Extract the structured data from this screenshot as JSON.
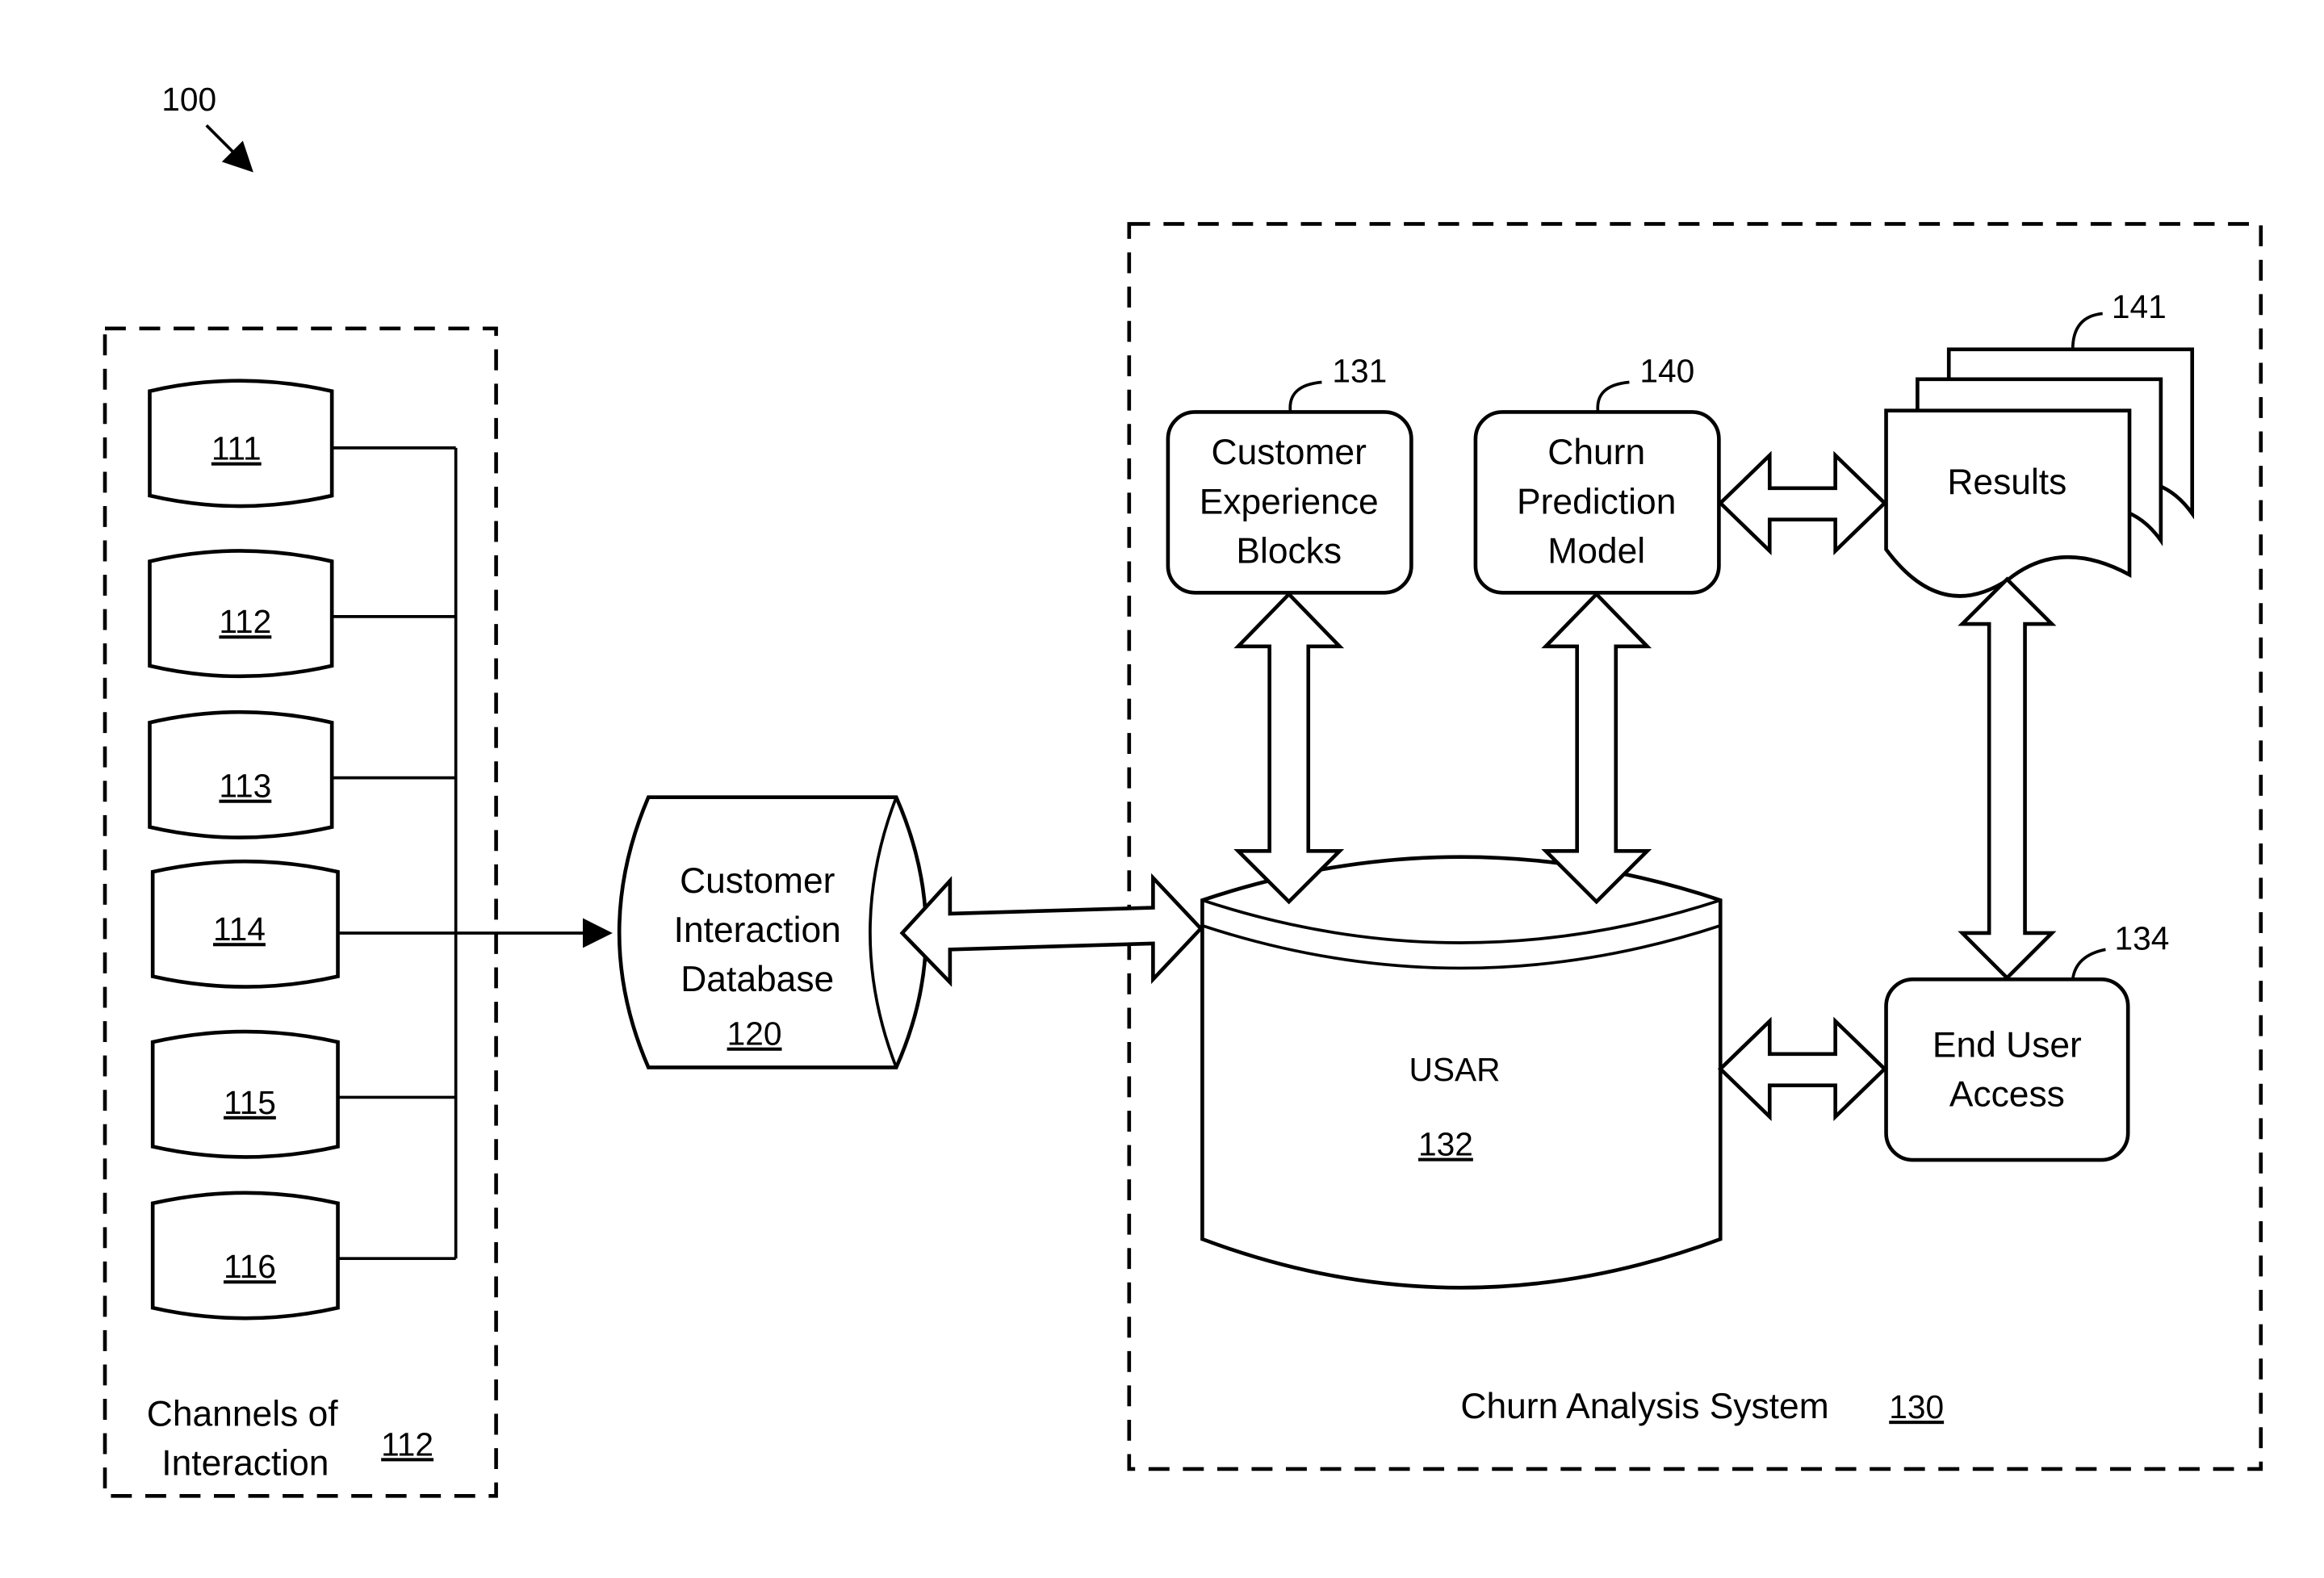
{
  "figure_ref": "100",
  "channels_group": {
    "label_line1": "Channels of",
    "label_line2": "Interaction",
    "ref": "112",
    "channels": [
      "111",
      "112",
      "113",
      "114",
      "115",
      "116"
    ]
  },
  "database": {
    "line1": "Customer",
    "line2": "Interaction",
    "line3": "Database",
    "ref": "120"
  },
  "system": {
    "label": "Churn Analysis System",
    "ref": "130",
    "cx_blocks": {
      "line1": "Customer",
      "line2": "Experience",
      "line3": "Blocks",
      "ref": "131"
    },
    "model": {
      "line1": "Churn",
      "line2": "Prediction",
      "line3": "Model",
      "ref": "140"
    },
    "results": {
      "label": "Results",
      "ref": "141"
    },
    "usar": {
      "label": "USAR",
      "ref": "132"
    },
    "end_user": {
      "line1": "End User",
      "line2": "Access",
      "ref": "134"
    }
  }
}
